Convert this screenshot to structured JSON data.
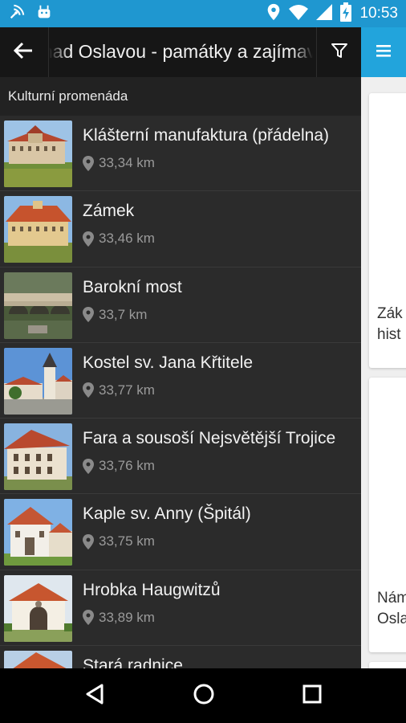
{
  "status_bar": {
    "time": "10:53",
    "icons": [
      "signal-broadcast-icon",
      "android-icon",
      "location-icon",
      "wifi-icon",
      "cell-signal-icon",
      "battery-charging-icon"
    ],
    "color": "#1f97d0"
  },
  "app_bar": {
    "title": "Náměšť nad Oslavou - památky a zajímavosti",
    "back_icon": "arrow-back-icon",
    "filter_icon": "filter-icon"
  },
  "section": {
    "label": "Kulturní promenáda"
  },
  "items": [
    {
      "name": "Klášterní manufaktura (přádelna)",
      "distance": "33,34 km"
    },
    {
      "name": "Zámek",
      "distance": "33,46 km"
    },
    {
      "name": "Barokní most",
      "distance": "33,7 km"
    },
    {
      "name": "Kostel sv. Jana Křtitele",
      "distance": "33,77 km"
    },
    {
      "name": "Fara a sousoší Nejsvětější Trojice",
      "distance": "33,76 km"
    },
    {
      "name": "Kaple sv. Anny (Špitál)",
      "distance": "33,75 km"
    },
    {
      "name": "Hrobka Haugwitzů",
      "distance": "33,89 km"
    },
    {
      "name": "Stará radnice",
      "distance": ""
    }
  ],
  "background_page": {
    "menu_icon": "hamburger-menu-icon",
    "card1_lines": [
      "Zák",
      "hist"
    ],
    "card2_lines": [
      "Nám",
      "Osla"
    ]
  },
  "nav_bar": {
    "icons": [
      "back-triangle-icon",
      "home-circle-icon",
      "recents-square-icon"
    ]
  }
}
